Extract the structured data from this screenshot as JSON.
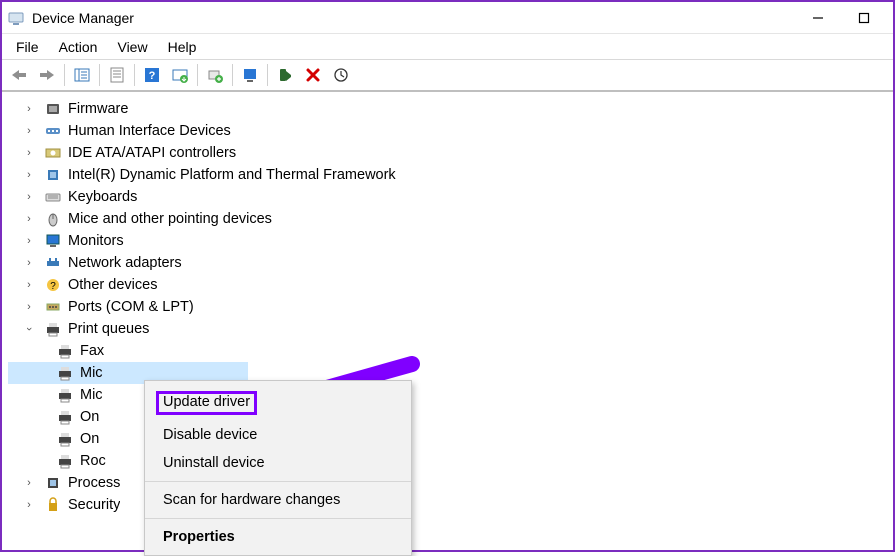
{
  "window": {
    "title": "Device Manager"
  },
  "menu": {
    "file": "File",
    "action": "Action",
    "view": "View",
    "help": "Help"
  },
  "tree": {
    "firmware": "Firmware",
    "hid": "Human Interface Devices",
    "ide": "IDE ATA/ATAPI controllers",
    "intel": "Intel(R) Dynamic Platform and Thermal Framework",
    "keyboards": "Keyboards",
    "mice": "Mice and other pointing devices",
    "monitors": "Monitors",
    "network": "Network adapters",
    "other": "Other devices",
    "ports": "Ports (COM & LPT)",
    "printqueues": "Print queues",
    "pq_fax": "Fax",
    "pq_mic1": "Mic",
    "pq_mic2": "Mic",
    "pq_on1": "On",
    "pq_on2": "On",
    "pq_roc": "Roc",
    "processors": "Process",
    "security": "Security"
  },
  "context_menu": {
    "update": "Update driver",
    "disable": "Disable device",
    "uninstall": "Uninstall device",
    "scan": "Scan for hardware changes",
    "properties": "Properties"
  },
  "annotation": {
    "color": "#8000ff"
  }
}
